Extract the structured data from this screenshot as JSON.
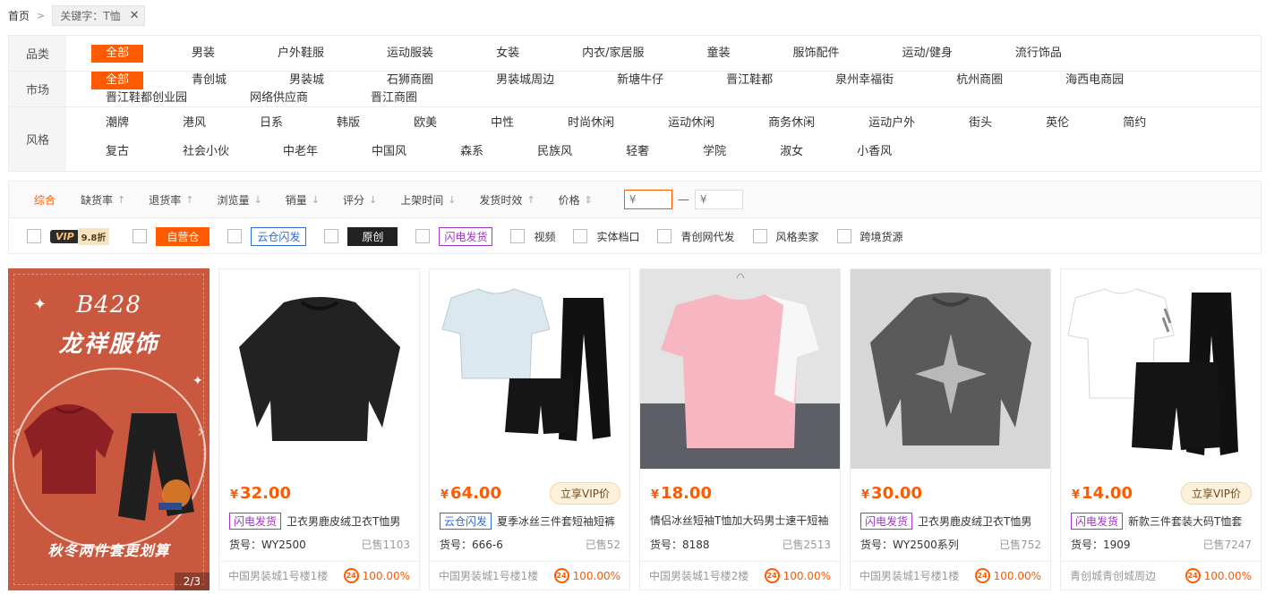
{
  "breadcrumb": {
    "home": "首页",
    "tag": "关键字：T恤"
  },
  "filters": {
    "category": {
      "label": "品类",
      "options": [
        "全部",
        "男装",
        "户外鞋服",
        "运动服装",
        "女装",
        "内衣/家居服",
        "童装",
        "服饰配件",
        "运动/健身",
        "流行饰品"
      ]
    },
    "market": {
      "label": "市场",
      "options": [
        "全部",
        "青创城",
        "男装城",
        "石狮商圈",
        "男装城周边",
        "新塘牛仔",
        "晋江鞋都",
        "泉州幸福街",
        "杭州商圈",
        "海西电商园",
        "晋江鞋都创业园",
        "网络供应商",
        "晋江商圈"
      ]
    },
    "style": {
      "label": "风格",
      "options": [
        "潮牌",
        "港风",
        "日系",
        "韩版",
        "欧美",
        "中性",
        "时尚休闲",
        "运动休闲",
        "商务休闲",
        "运动户外",
        "街头",
        "英伦",
        "简约",
        "复古",
        "社会小伙",
        "中老年",
        "中国风",
        "森系",
        "民族风",
        "轻奢",
        "学院",
        "淑女",
        "小香风"
      ]
    }
  },
  "sorts": [
    {
      "label": "综合",
      "arrow": ""
    },
    {
      "label": "缺货率",
      "arrow": "↑"
    },
    {
      "label": "退货率",
      "arrow": "↑"
    },
    {
      "label": "浏览量",
      "arrow": "↓"
    },
    {
      "label": "销量",
      "arrow": "↓"
    },
    {
      "label": "评分",
      "arrow": "↓"
    },
    {
      "label": "上架时间",
      "arrow": "↓"
    },
    {
      "label": "发货时效",
      "arrow": "↑"
    },
    {
      "label": "价格",
      "arrow": "⇕"
    }
  ],
  "price_range": {
    "min_placeholder": "¥",
    "max_placeholder": "¥",
    "dash": "—"
  },
  "checks": {
    "vip": "VIP",
    "vip_discount": "9.8折",
    "self": "自营仓",
    "cloud": "云仓闪发",
    "original": "原创",
    "flash": "闪电发货",
    "video": "视频",
    "store": "实体档口",
    "agent": "青创网代发",
    "style_seller": "风格卖家",
    "cross": "跨境货源"
  },
  "banner": {
    "code": "B428",
    "brand": "龙祥服饰",
    "slogan": "秋冬两件套更划算",
    "pager": "2/3"
  },
  "products": [
    {
      "price": "32.00",
      "vip_btn": "",
      "tag": "闪电发货",
      "tag_type": "flash",
      "title": "卫衣男鹿皮绒卫衣T恤男",
      "sku": "货号：WY2500",
      "sold": "已售1103",
      "loc": "中国男装城1号楼1楼",
      "rate": "100.00%"
    },
    {
      "price": "64.00",
      "vip_btn": "立享VIP价",
      "tag": "云仓闪发",
      "tag_type": "cloud",
      "title": "夏季冰丝三件套短袖短裤",
      "sku": "货号：666-6",
      "sold": "已售52",
      "loc": "中国男装城1号楼1楼",
      "rate": "100.00%"
    },
    {
      "price": "18.00",
      "vip_btn": "",
      "tag": "",
      "tag_type": "",
      "title": "情侣冰丝短袖T恤加大码男士速干短袖",
      "sku": "货号：8188",
      "sold": "已售2513",
      "loc": "中国男装城1号楼2楼",
      "rate": "100.00%"
    },
    {
      "price": "30.00",
      "vip_btn": "",
      "tag": "闪电发货",
      "tag_type": "flash",
      "title": "卫衣男鹿皮绒卫衣T恤男",
      "sku": "货号：WY2500系列",
      "sold": "已售752",
      "loc": "中国男装城1号楼1楼",
      "rate": "100.00%"
    },
    {
      "price": "14.00",
      "vip_btn": "立享VIP价",
      "tag": "闪电发货",
      "tag_type": "flash",
      "title": "新款三件套装大码T恤套",
      "sku": "货号：1909",
      "sold": "已售7247",
      "loc": "青创城青创城周边",
      "rate": "100.00%"
    }
  ],
  "currency": "¥",
  "badge24": "24",
  "colors": {
    "accent": "#ff5a00",
    "flash": "#a034c8",
    "cloud": "#2f6bd3"
  }
}
